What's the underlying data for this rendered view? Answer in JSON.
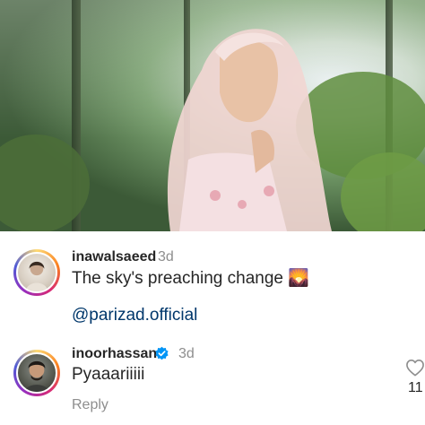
{
  "comments": [
    {
      "username": "inawalsaeed",
      "time": "3d",
      "text": "The sky's preaching change",
      "emoji": "🌄",
      "mention": "@parizad.official"
    },
    {
      "username": "inoorhassan",
      "verified": true,
      "time": "3d",
      "text": "Pyaaariiiii",
      "reply_label": "Reply",
      "like_count": "11"
    }
  ],
  "colors": {
    "text": "#262626",
    "secondary": "#8e8e8e",
    "mention": "#00376b",
    "verified": "#0095f6"
  }
}
